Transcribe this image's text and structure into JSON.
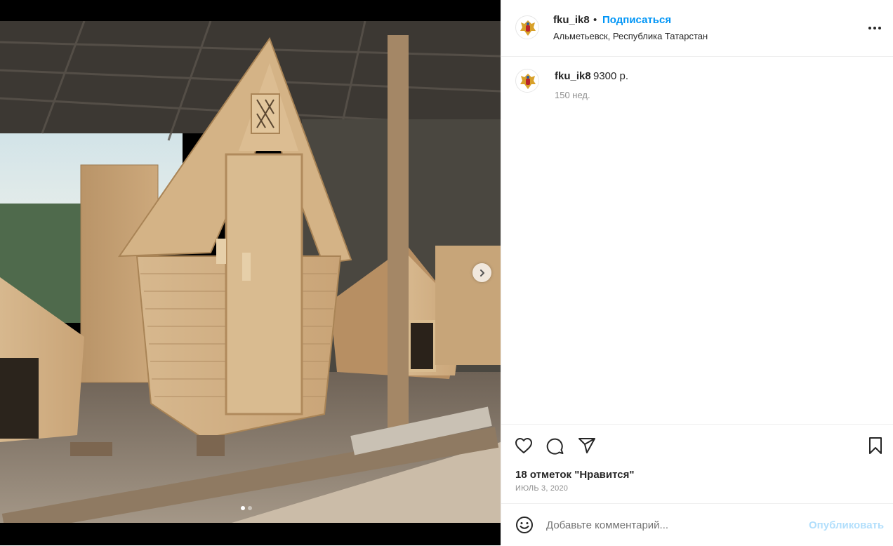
{
  "post": {
    "username": "fku_ik8",
    "separator": "•",
    "follow_label": "Подписаться",
    "location": "Альметьевск, Республика Татарстан"
  },
  "caption": {
    "username": "fku_ik8",
    "text": "9300 р.",
    "time": "150 нед."
  },
  "stats": {
    "likes": "18 отметок \"Нравится\"",
    "date": "ИЮЛЬ 3, 2020"
  },
  "comment": {
    "placeholder": "Добавьте комментарий...",
    "publish_label": "Опубликовать"
  },
  "icons": {
    "like": "heart-icon",
    "comment": "comment-icon",
    "share": "paper-plane-icon",
    "save": "bookmark-icon",
    "more": "more-horizontal-icon",
    "emoji": "emoji-icon",
    "next": "chevron-right-icon"
  },
  "carousel": {
    "total": 2,
    "current": 1
  },
  "colors": {
    "accent": "#0095f6",
    "publish_disabled": "#b2dffc",
    "muted": "#8e8e8e"
  }
}
